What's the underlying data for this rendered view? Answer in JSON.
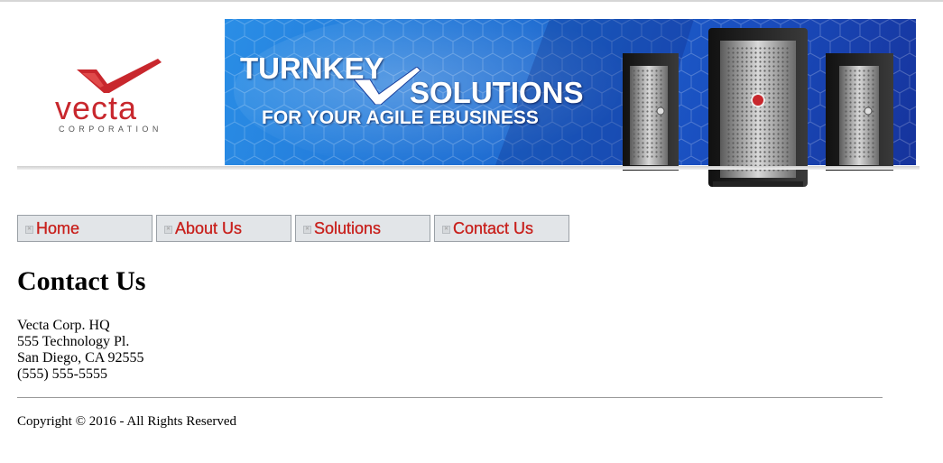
{
  "header": {
    "logo": {
      "wordmark": "vecta",
      "subtitle": "CORPORATION"
    },
    "banner": {
      "line1": "TURNKEY",
      "line2": "SOLUTIONS",
      "line3": "FOR YOUR AGILE EBUSINESS"
    }
  },
  "nav": {
    "items": [
      {
        "label": "Home"
      },
      {
        "label": "About Us"
      },
      {
        "label": "Solutions"
      },
      {
        "label": "Contact Us"
      }
    ]
  },
  "main": {
    "title": "Contact Us",
    "address": [
      "Vecta Corp. HQ",
      "555 Technology Pl.",
      "San Diego, CA 92555",
      "(555) 555-5555"
    ]
  },
  "footer": {
    "copyright": "Copyright © 2016 - All Rights Reserved"
  },
  "colors": {
    "brand_red": "#c8201c",
    "banner_blue": "#1f6fd3",
    "nav_bg": "#e2e5e8"
  }
}
